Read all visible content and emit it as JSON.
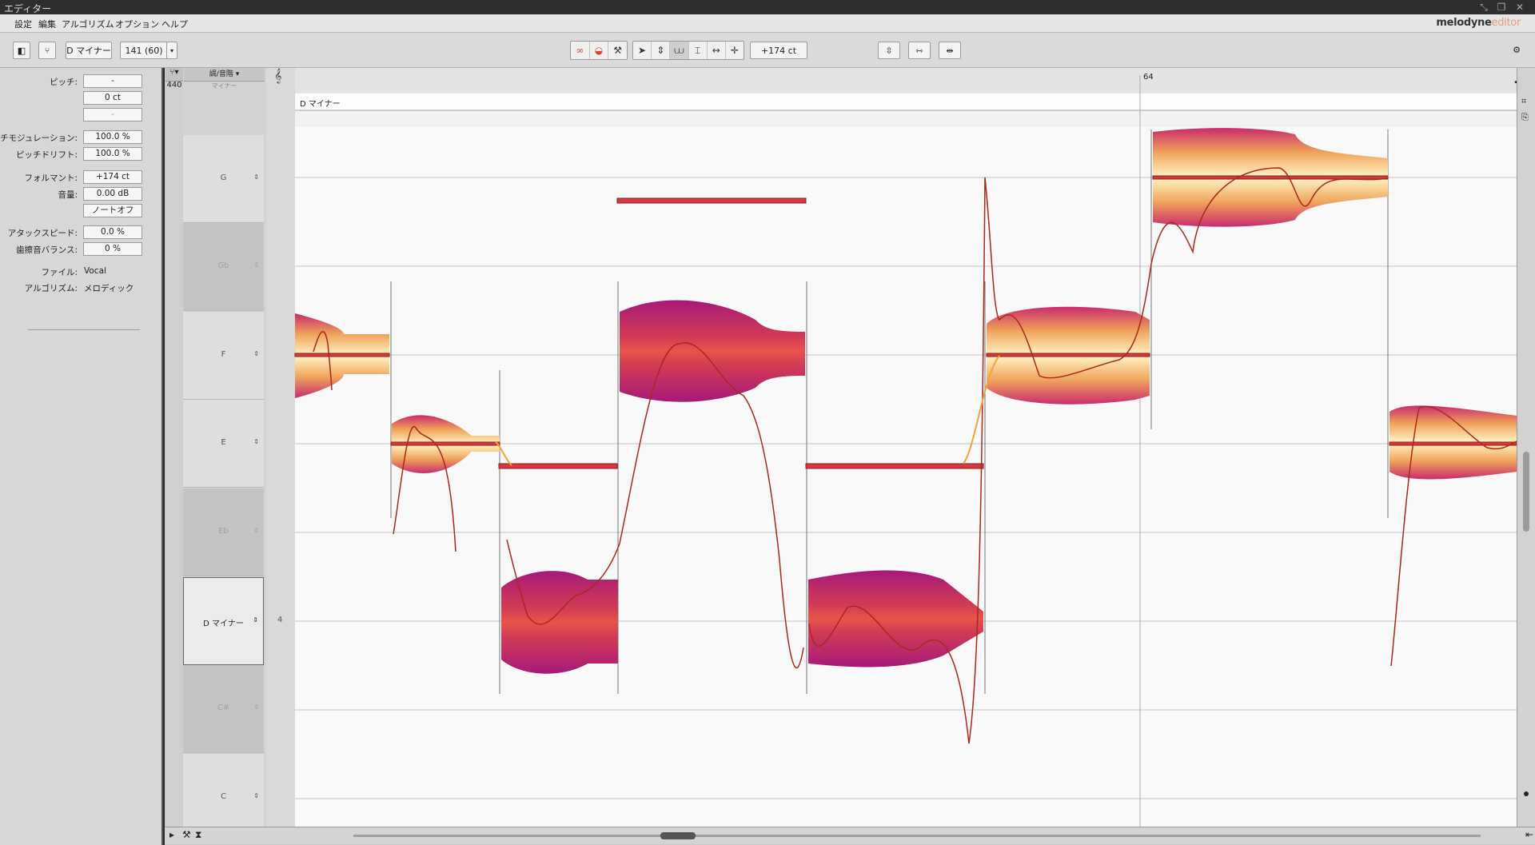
{
  "window": {
    "title": "エディター"
  },
  "menu": {
    "items": [
      "設定",
      "編集",
      "アルゴリズム",
      "オプション",
      "ヘルプ"
    ]
  },
  "brand": {
    "name": "melodyne",
    "edition": "editor"
  },
  "toolbar": {
    "key_label": "D マイナー",
    "tempo_label": "141 (60)",
    "cent_readout": "+174 ct",
    "group1_icons": [
      "pitch-blend-icon",
      "pitch-tool-icon",
      "pitch-modulation-icon"
    ],
    "group2_icons": [
      "pointer-tool-icon",
      "pitch-move-icon",
      "formant-tool-icon",
      "amplitude-tool-icon",
      "time-tool-icon",
      "note-separation-icon"
    ],
    "right_icons": [
      "correct-pitch-icon",
      "quantize-time-icon",
      "split-icon",
      "settings-gear-icon"
    ]
  },
  "inspector": {
    "pitch_label": "ピッチ:",
    "pitch_value": "-",
    "pitch_cents": "0 ct",
    "pitch_extra": "-",
    "modulation_label": "ピッチモジュレーション:",
    "modulation_value": "100.0 %",
    "drift_label": "ピッチドリフト:",
    "drift_value": "100.0 %",
    "formant_label": "フォルマント:",
    "formant_value": "+174 ct",
    "volume_label": "音量:",
    "volume_value": "0.00 dB",
    "note_off_label": "ノートオフ",
    "attack_label": "アタックスピード:",
    "attack_value": "0.0 %",
    "sibilant_label": "歯擦音バランス:",
    "sibilant_value": "0 %",
    "file_label": "ファイル:",
    "file_value": "Vocal",
    "algorithm_label": "アルゴリズム:",
    "algorithm_value": "メロディック"
  },
  "editor": {
    "reference_hz": "440",
    "scale_header": "調/音階",
    "scale_subheader": "マイナー",
    "bar_number": "64",
    "scale_ribbon": "D マイナー",
    "keys": [
      {
        "name": "G",
        "type": "light"
      },
      {
        "name": "Gb",
        "type": "dark"
      },
      {
        "name": "F",
        "type": "light"
      },
      {
        "name": "E",
        "type": "light"
      },
      {
        "name": "Eb",
        "type": "dark"
      },
      {
        "name": "D マイナー",
        "type": "sel"
      },
      {
        "name": "C#",
        "type": "dark"
      },
      {
        "name": "C",
        "type": "light"
      }
    ],
    "octave_marker": "4"
  }
}
